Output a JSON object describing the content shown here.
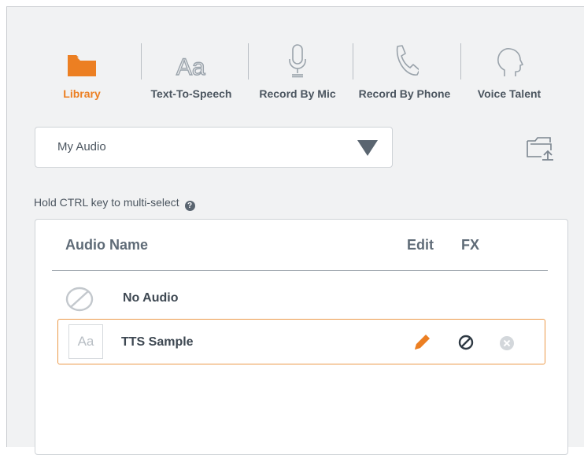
{
  "tabs": [
    {
      "label": "Library",
      "icon": "folder-icon",
      "active": true
    },
    {
      "label": "Text-To-Speech",
      "icon": "text-aa-icon",
      "active": false
    },
    {
      "label": "Record By Mic",
      "icon": "microphone-icon",
      "active": false
    },
    {
      "label": "Record By Phone",
      "icon": "phone-icon",
      "active": false
    },
    {
      "label": "Voice Talent",
      "icon": "head-icon",
      "active": false
    }
  ],
  "dropdown": {
    "selected": "My Audio",
    "icon": "caret-down-icon"
  },
  "upload": {
    "icon": "folder-upload-icon"
  },
  "hint": {
    "text": "Hold CTRL key to multi-select",
    "icon": "help-icon",
    "help_glyph": "?"
  },
  "list": {
    "columns": {
      "name": "Audio Name",
      "edit": "Edit",
      "fx": "FX"
    },
    "rows": [
      {
        "name": "No Audio",
        "icon": "no-audio-icon",
        "selected": false
      },
      {
        "name": "TTS Sample",
        "thumb": "Aa",
        "selected": true,
        "actions": {
          "edit": "pencil-icon",
          "fx": "fx-off-icon",
          "remove": "remove-icon"
        }
      }
    ]
  },
  "colors": {
    "accent": "#ec7f22",
    "text": "#4c5660",
    "background": "#f1f2f3",
    "selection_border": "#ec9a4a"
  }
}
